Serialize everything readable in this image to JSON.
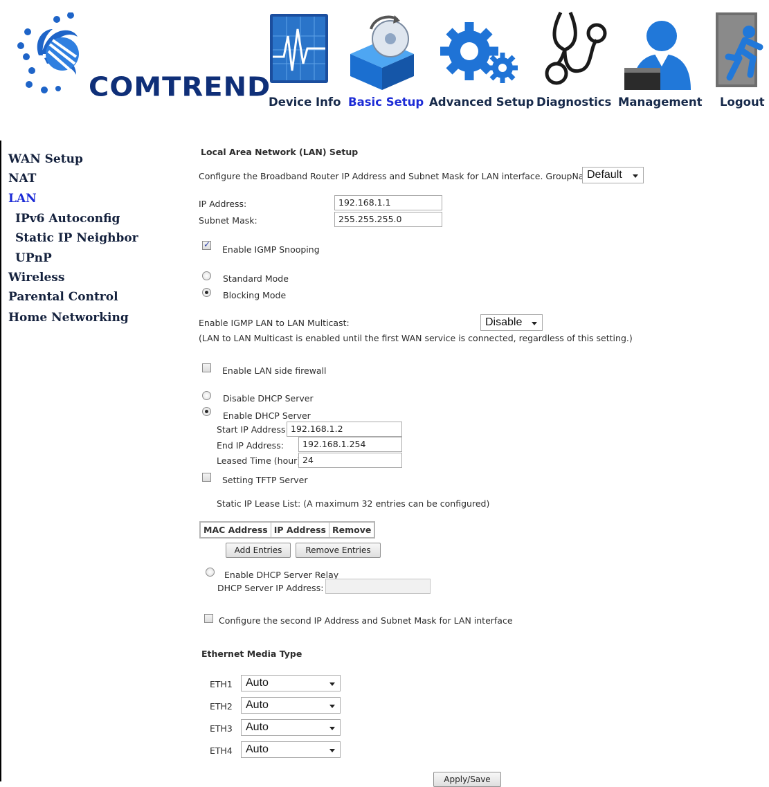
{
  "brand": {
    "logo_text": "COMTREND"
  },
  "nav": [
    {
      "label": "Device Info",
      "icon": "chart-monitor-icon"
    },
    {
      "label": "Basic Setup",
      "icon": "disc-box-icon",
      "active": true
    },
    {
      "label": "Advanced Setup",
      "icon": "gears-icon"
    },
    {
      "label": "Diagnostics",
      "icon": "stethoscope-icon"
    },
    {
      "label": "Management",
      "icon": "admin-user-icon"
    },
    {
      "label": "Logout",
      "icon": "exit-door-icon"
    }
  ],
  "sidebar": [
    {
      "label": "WAN Setup"
    },
    {
      "label": "NAT"
    },
    {
      "label": "LAN",
      "active": true
    },
    {
      "label": "IPv6 Autoconfig",
      "sub": true
    },
    {
      "label": "Static IP Neighbor",
      "sub": true
    },
    {
      "label": "UPnP",
      "sub": true
    },
    {
      "label": "Wireless"
    },
    {
      "label": "Parental Control"
    },
    {
      "label": "Home Networking"
    }
  ],
  "page": {
    "title": "Local Area Network (LAN) Setup",
    "intro": "Configure the Broadband Router IP Address and Subnet Mask for LAN interface.  GroupName",
    "group_name": "Default",
    "ip_label": "IP Address:",
    "ip_value": "192.168.1.1",
    "mask_label": "Subnet Mask:",
    "mask_value": "255.255.255.0",
    "igmp_snooping_label": "Enable IGMP Snooping",
    "igmp_snooping_checked": true,
    "standard_mode_label": "Standard Mode",
    "blocking_mode_label": "Blocking Mode",
    "blocking_mode_selected": true,
    "igmp_lan_label": "Enable IGMP LAN to LAN Multicast:",
    "igmp_lan_value": "Disable",
    "igmp_lan_note": "(LAN to LAN Multicast is enabled until the first WAN service is connected, regardless of this setting.)",
    "lan_firewall_label": "Enable LAN side firewall",
    "disable_dhcp_label": "Disable DHCP Server",
    "enable_dhcp_label": "Enable DHCP Server",
    "enable_dhcp_selected": true,
    "start_ip_label": "Start IP Address:",
    "start_ip_value": "192.168.1.2",
    "end_ip_label": "End IP Address:",
    "end_ip_value": "192.168.1.254",
    "lease_label": "Leased Time (hour):",
    "lease_value": "24",
    "tftp_label": "Setting TFTP Server",
    "static_lease_note": "Static IP Lease List: (A maximum 32 entries can be configured)",
    "lease_table_headers": [
      "MAC Address",
      "IP Address",
      "Remove"
    ],
    "add_entries": "Add Entries",
    "remove_entries": "Remove Entries",
    "relay_label": "Enable DHCP Server Relay",
    "relay_ip_label": "DHCP Server IP Address:",
    "relay_ip_value": "",
    "second_ip_label": "Configure the second IP Address and Subnet Mask for LAN interface",
    "eth_title": "Ethernet Media Type",
    "eth_ports": [
      {
        "name": "ETH1",
        "value": "Auto"
      },
      {
        "name": "ETH2",
        "value": "Auto"
      },
      {
        "name": "ETH3",
        "value": "Auto"
      },
      {
        "name": "ETH4",
        "value": "Auto"
      }
    ],
    "apply_label": "Apply/Save"
  }
}
